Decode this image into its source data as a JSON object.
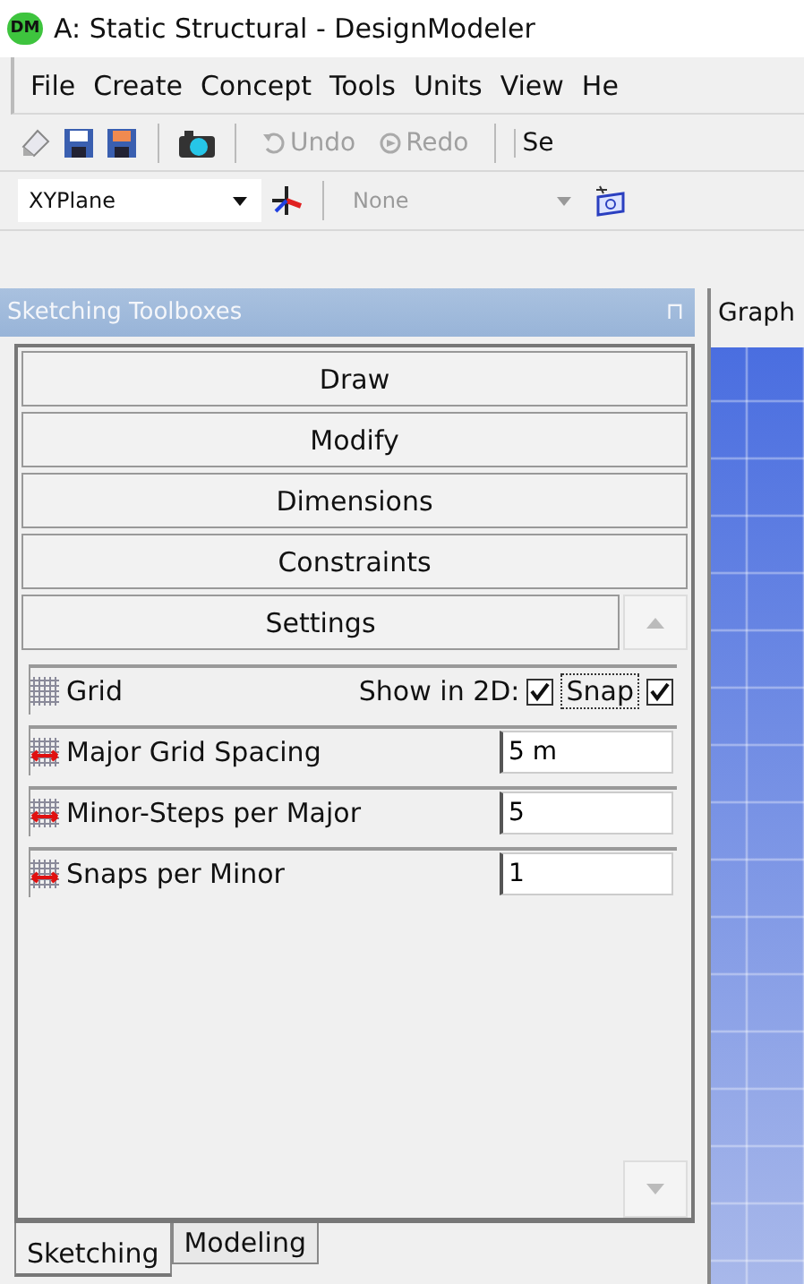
{
  "window": {
    "title": "A: Static Structural - DesignModeler",
    "logo": "DM"
  },
  "menu": [
    "File",
    "Create",
    "Concept",
    "Tools",
    "Units",
    "View",
    "He"
  ],
  "toolbar": {
    "buttons": [
      {
        "kind": "icon"
      },
      {
        "kind": "icon"
      },
      {
        "kind": "icon"
      },
      {
        "kind": "sep"
      },
      {
        "kind": "icon"
      },
      {
        "kind": "sep"
      },
      {
        "kind": "text",
        "label": "Undo",
        "disabled": true
      },
      {
        "kind": "text",
        "label": "Redo",
        "disabled": true
      },
      {
        "kind": "sep"
      },
      {
        "kind": "label",
        "label": "Se"
      }
    ]
  },
  "plane_bar": {
    "plane": {
      "value": "XYPlane",
      "disabled": false
    },
    "sketch": {
      "value": "None",
      "disabled": true
    }
  },
  "panel": {
    "title": "Sketching Toolboxes",
    "pin": "⊓"
  },
  "graphics": {
    "tab": "Graph"
  },
  "toolboxes": [
    {
      "label": "Draw",
      "expanded": false
    },
    {
      "label": "Modify",
      "expanded": false
    },
    {
      "label": "Dimensions",
      "expanded": false
    },
    {
      "label": "Constraints",
      "expanded": false
    },
    {
      "label": "Settings",
      "expanded": true
    }
  ],
  "settings": [
    {
      "kind": "toggles",
      "label": "Grid",
      "show_label": "Show in 2D:",
      "show_checked": true,
      "snap_label": "Snap",
      "snap_checked": true
    },
    {
      "kind": "field",
      "label": "Major Grid Spacing",
      "value": "5 m"
    },
    {
      "kind": "field",
      "label": "Minor-Steps per Major",
      "value": "5"
    },
    {
      "kind": "field",
      "label": "Snaps per Minor",
      "value": "1"
    }
  ],
  "tabs": [
    {
      "label": "Sketching",
      "selected": true
    },
    {
      "label": "Modeling",
      "selected": false
    }
  ]
}
